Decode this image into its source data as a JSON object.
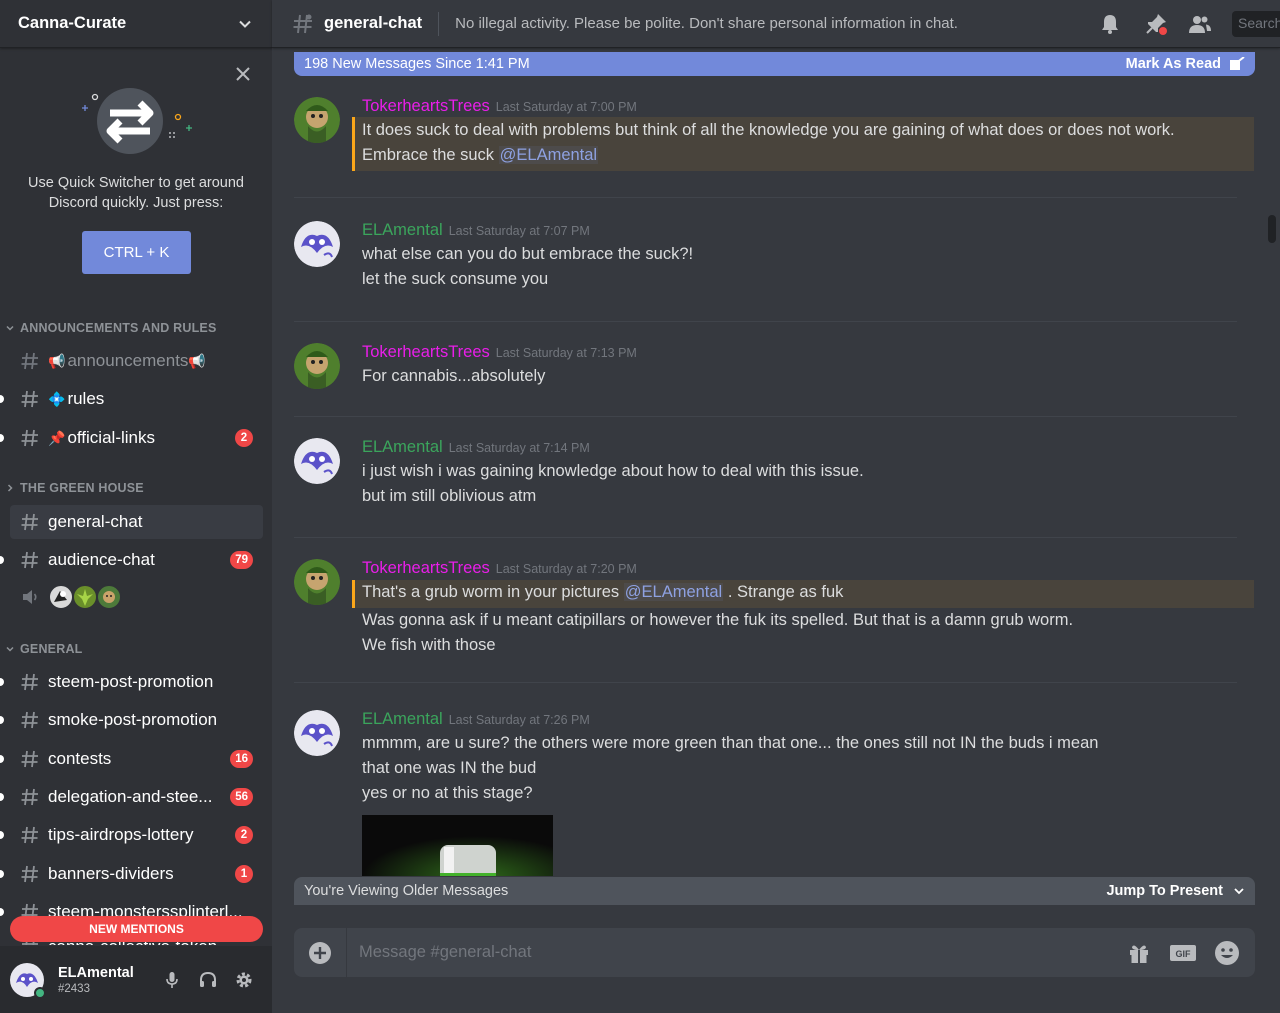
{
  "server": {
    "name": "Canna-Curate"
  },
  "quick_switcher": {
    "text_line1": "Use Quick Switcher to get around",
    "text_line2": "Discord quickly. Just press:",
    "shortcut": "CTRL + K"
  },
  "categories": [
    {
      "name": "ANNOUNCEMENTS AND RULES"
    },
    {
      "name": "THE GREEN HOUSE"
    },
    {
      "name": "GENERAL"
    }
  ],
  "channels": [
    {
      "name": "announcements",
      "prefix_emoji": "📢",
      "suffix_emoji": "📢",
      "badge": ""
    },
    {
      "name": "rules",
      "prefix_emoji": "💠",
      "badge": ""
    },
    {
      "name": "official-links",
      "prefix_emoji": "📌",
      "badge": "2"
    },
    {
      "name": "general-chat",
      "badge": ""
    },
    {
      "name": "audience-chat",
      "badge": "79"
    },
    {
      "name": "steem-post-promotion",
      "badge": ""
    },
    {
      "name": "smoke-post-promotion",
      "badge": ""
    },
    {
      "name": "contests",
      "badge": "16"
    },
    {
      "name": "delegation-and-stee...",
      "badge": "56"
    },
    {
      "name": "tips-airdrops-lottery",
      "badge": "2"
    },
    {
      "name": "banners-dividers",
      "badge": "1"
    },
    {
      "name": "steem-monsterssplinterl...",
      "badge": ""
    },
    {
      "name": "canna-collective-token",
      "badge": ""
    }
  ],
  "new_mentions_label": "NEW MENTIONS",
  "user": {
    "name": "ELAmental",
    "tag": "#2433"
  },
  "header": {
    "channel": "general-chat",
    "topic": "No illegal activity. Please be polite. Don't share personal information in chat.",
    "search_placeholder": "Search"
  },
  "new_messages_bar": {
    "text": "198 New Messages Since 1:41 PM",
    "action": "Mark As Read"
  },
  "messages": [
    {
      "author": "TokerheartsTrees",
      "timestamp": "Last Saturday at 7:00 PM",
      "line1": "It does suck to deal with problems but think of all the knowledge you are gaining of what does or does not work.",
      "line2_prefix": "Embrace the suck ",
      "mention": "@ELAmental"
    },
    {
      "author": "ELAmental",
      "timestamp": "Last Saturday at 7:07 PM",
      "line1": "what else can you do but embrace the suck?!",
      "line2": "let the suck consume you"
    },
    {
      "author": "TokerheartsTrees",
      "timestamp": "Last Saturday at 7:13 PM",
      "line1": "For cannabis...absolutely"
    },
    {
      "author": "ELAmental",
      "timestamp": "Last Saturday at 7:14 PM",
      "line1": "i just wish i was gaining knowledge about how to deal with this issue.",
      "line2": "but im still oblivious atm"
    },
    {
      "author": "TokerheartsTrees",
      "timestamp": "Last Saturday at 7:20 PM",
      "line1_prefix": "That's a grub worm in your pictures ",
      "mention": "@ELAmental",
      "line1_suffix": " . Strange as fuk",
      "line2": "Was gonna ask if u meant catipillars or however the fuk its spelled. But that is a damn grub worm.",
      "line3": "We fish with those"
    },
    {
      "author": "ELAmental",
      "timestamp": "Last Saturday at 7:26 PM",
      "line1": "mmmm, are u sure? the others were more green than that one... the ones still not IN the buds i mean",
      "line2": "that one was IN the bud",
      "line3": "yes or no at this stage?"
    }
  ],
  "older_bar": {
    "text": "You're Viewing Older Messages",
    "action": "Jump To Present"
  },
  "composer": {
    "placeholder": "Message #general-chat"
  },
  "colors": {
    "toker": "#e91ee9",
    "elamental": "#3ba55c",
    "accent": "#7289da",
    "mention_highlight": "#faa61a",
    "badge": "#f04747"
  }
}
